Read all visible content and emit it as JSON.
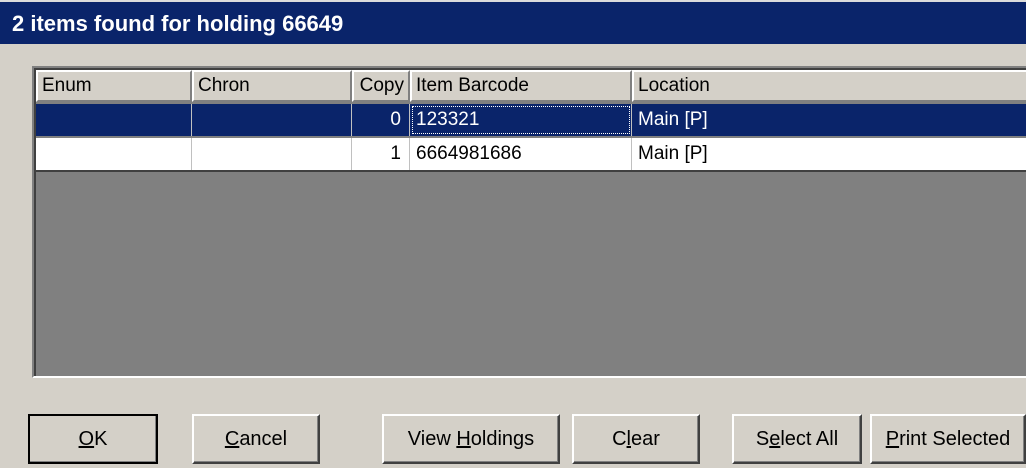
{
  "window": {
    "title": "2 items found for holding 66649"
  },
  "table": {
    "columns": [
      "Enum",
      "Chron",
      "Copy",
      "Item Barcode",
      "Location"
    ],
    "rows": [
      {
        "enum": "",
        "chron": "",
        "copy": "0",
        "barcode": "123321",
        "location": "Main [P]",
        "selected": true
      },
      {
        "enum": "",
        "chron": "",
        "copy": "1",
        "barcode": "6664981686",
        "location": "Main [P]",
        "selected": false
      }
    ]
  },
  "buttons": {
    "ok": {
      "mnemonic": "O",
      "rest": "K"
    },
    "cancel": {
      "mnemonic": "C",
      "rest": "ancel"
    },
    "view_holdings": {
      "pre": "View ",
      "mnemonic": "H",
      "rest": "oldings"
    },
    "clear": {
      "pre": "C",
      "mnemonic": "l",
      "rest": "ear"
    },
    "select_all": {
      "pre": "S",
      "mnemonic": "e",
      "rest": "lect All"
    },
    "print_selected": {
      "mnemonic": "P",
      "rest": "rint Selected"
    }
  },
  "colors": {
    "titlebar": "#0a246a",
    "selection": "#0a246a",
    "face": "#d4d0c8",
    "empty_list": "#808080"
  }
}
